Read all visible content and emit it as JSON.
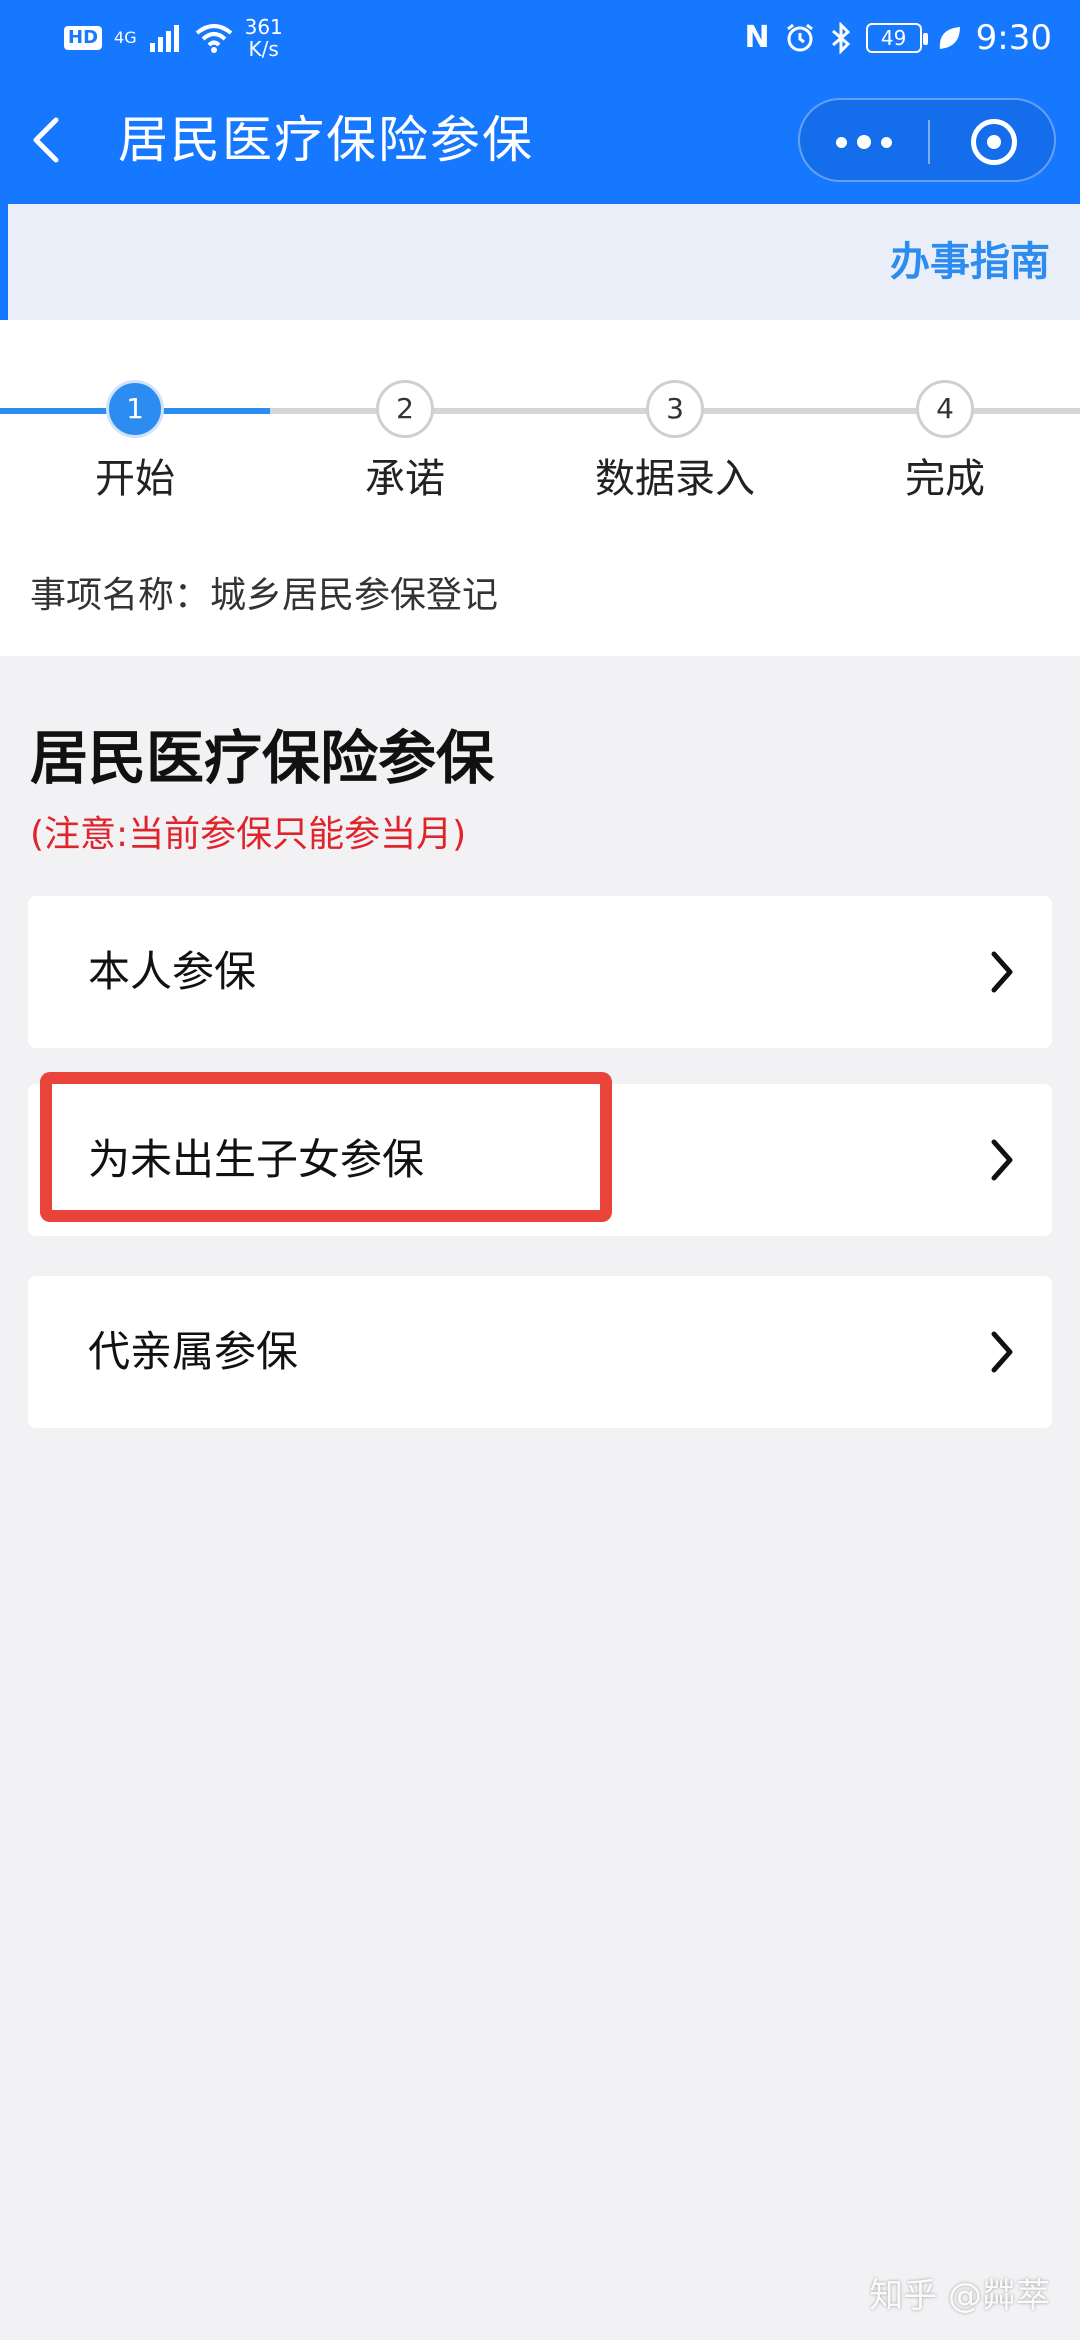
{
  "status_bar": {
    "hd": "HD",
    "network": "4G",
    "speed_value": "361",
    "speed_unit": "K/s",
    "nfc": "N",
    "battery": "49",
    "time": "9:30"
  },
  "nav": {
    "title": "居民医疗保险参保"
  },
  "guide": {
    "label": "办事指南"
  },
  "steps": {
    "current": 1,
    "items": [
      {
        "number": "1",
        "label": "开始"
      },
      {
        "number": "2",
        "label": "承诺"
      },
      {
        "number": "3",
        "label": "数据录入"
      },
      {
        "number": "4",
        "label": "完成"
      }
    ]
  },
  "item_name": "事项名称：城乡居民参保登记",
  "section": {
    "title": "居民医疗保险参保",
    "notice": "(注意:当前参保只能参当月)"
  },
  "options": [
    {
      "label": "本人参保"
    },
    {
      "label": "为未出生子女参保"
    },
    {
      "label": "代亲属参保"
    }
  ],
  "watermark": "知乎 @茻萃",
  "colors": {
    "primary": "#1677ff",
    "step_active": "#2d8cf0",
    "notice_red": "#e0242b",
    "highlight": "#e8443a"
  }
}
